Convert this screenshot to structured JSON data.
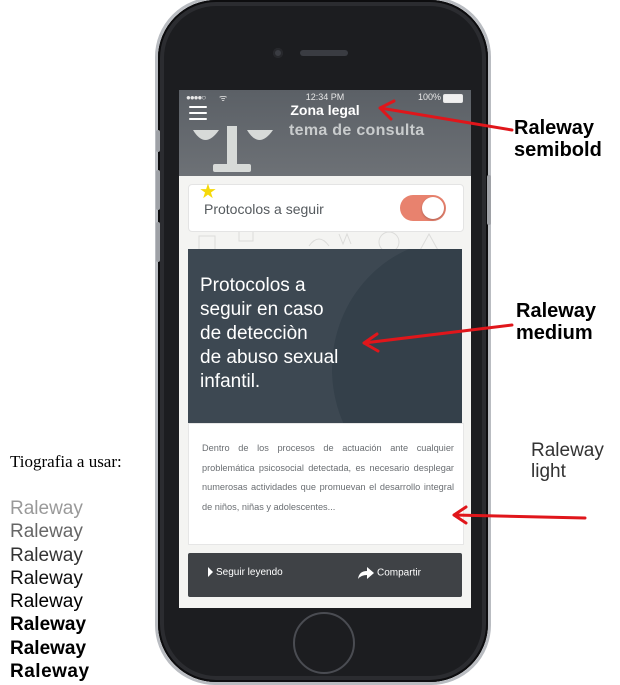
{
  "status_bar": {
    "signal": "●●●●○",
    "wifi": "ᯤ",
    "time": "12:34 PM",
    "battery": "100%"
  },
  "navbar": {
    "title": "Zona legal"
  },
  "hero": {
    "text": "tema de consulta"
  },
  "toggle_card": {
    "label": "Protocolos a seguir",
    "toggle_on": true,
    "toggle_color": "#e8826e",
    "star_color": "#f5d90a"
  },
  "feature_card": {
    "title_lines": [
      "Protocolos a",
      "seguir en caso",
      "de detecciòn",
      "de abuso sexual",
      "infantil."
    ],
    "background": "#3d4852"
  },
  "description": {
    "text": "Dentro de los procesos de actuación ante cualquier problemática psicosocial detectada, es necesario desplegar numerosas actividades que promuevan el desarrollo integral de niños, niñas y adolescentes..."
  },
  "actions": {
    "read_more": "Seguir leyendo",
    "share": "Compartir"
  },
  "annotations": {
    "semibold": [
      "Raleway",
      "semibold"
    ],
    "medium": [
      "Raleway",
      "medium"
    ],
    "light": [
      "Raleway",
      "light"
    ],
    "typography_label": "Tiografia a usar:",
    "arrow_color": "#e0161b"
  },
  "weight_samples": [
    "Raleway",
    "Raleway",
    "Raleway",
    "Raleway",
    "Raleway",
    "Raleway",
    "Raleway",
    "Raleway"
  ]
}
